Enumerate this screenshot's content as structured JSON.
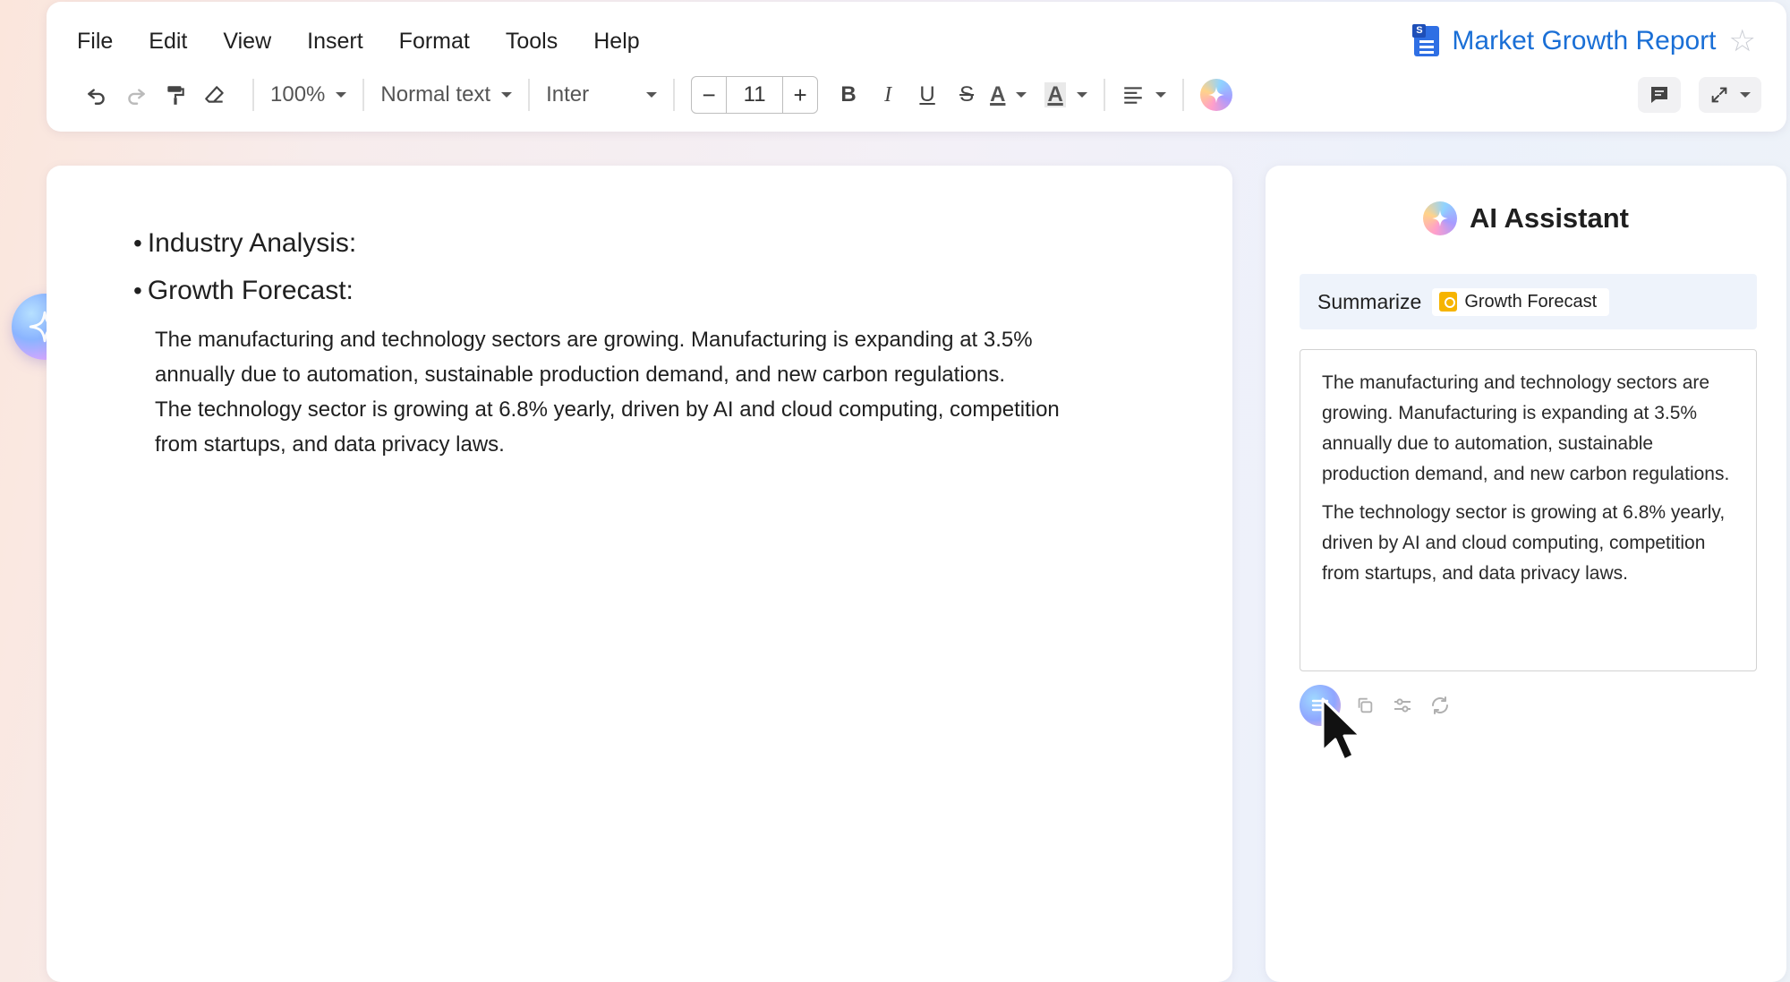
{
  "menu": [
    "File",
    "Edit",
    "View",
    "Insert",
    "Format",
    "Tools",
    "Help"
  ],
  "document": {
    "title": "Market Growth Report",
    "icon_badge": "S",
    "headings": [
      "Industry Analysis:",
      "Growth Forecast:"
    ],
    "paragraph_lines": [
      "The manufacturing and technology sectors are growing. Manufacturing is expanding at 3.5%",
      "annually due to automation, sustainable production demand, and new carbon regulations.",
      "The technology sector is growing at 6.8% yearly, driven by AI and cloud computing, competition",
      "from startups, and data privacy laws."
    ]
  },
  "toolbar": {
    "zoom": "100%",
    "style": "Normal text",
    "font": "Inter",
    "font_size": "11",
    "minus": "−",
    "plus": "+",
    "bold": "B",
    "italic": "I",
    "underline": "U",
    "strike": "S",
    "text_color": "A",
    "highlight": "A"
  },
  "assistant": {
    "title": "AI Assistant",
    "prompt_verb": "Summarize",
    "prompt_chip": "Growth Forecast",
    "answer_paragraphs": [
      "The manufacturing and technology sectors are growing. Manufacturing is expanding at 3.5% annually due to automation, sustainable production demand, and new carbon regulations.",
      "The technology sector is growing at 6.8% yearly, driven by AI and cloud computing, competition from startups, and data privacy laws."
    ]
  },
  "colors": {
    "accent": "#1a6fd6",
    "doc_icon": "#2f6fe4",
    "prompt_bg": "#eef3fb",
    "chip_icon": "#f6b400"
  }
}
